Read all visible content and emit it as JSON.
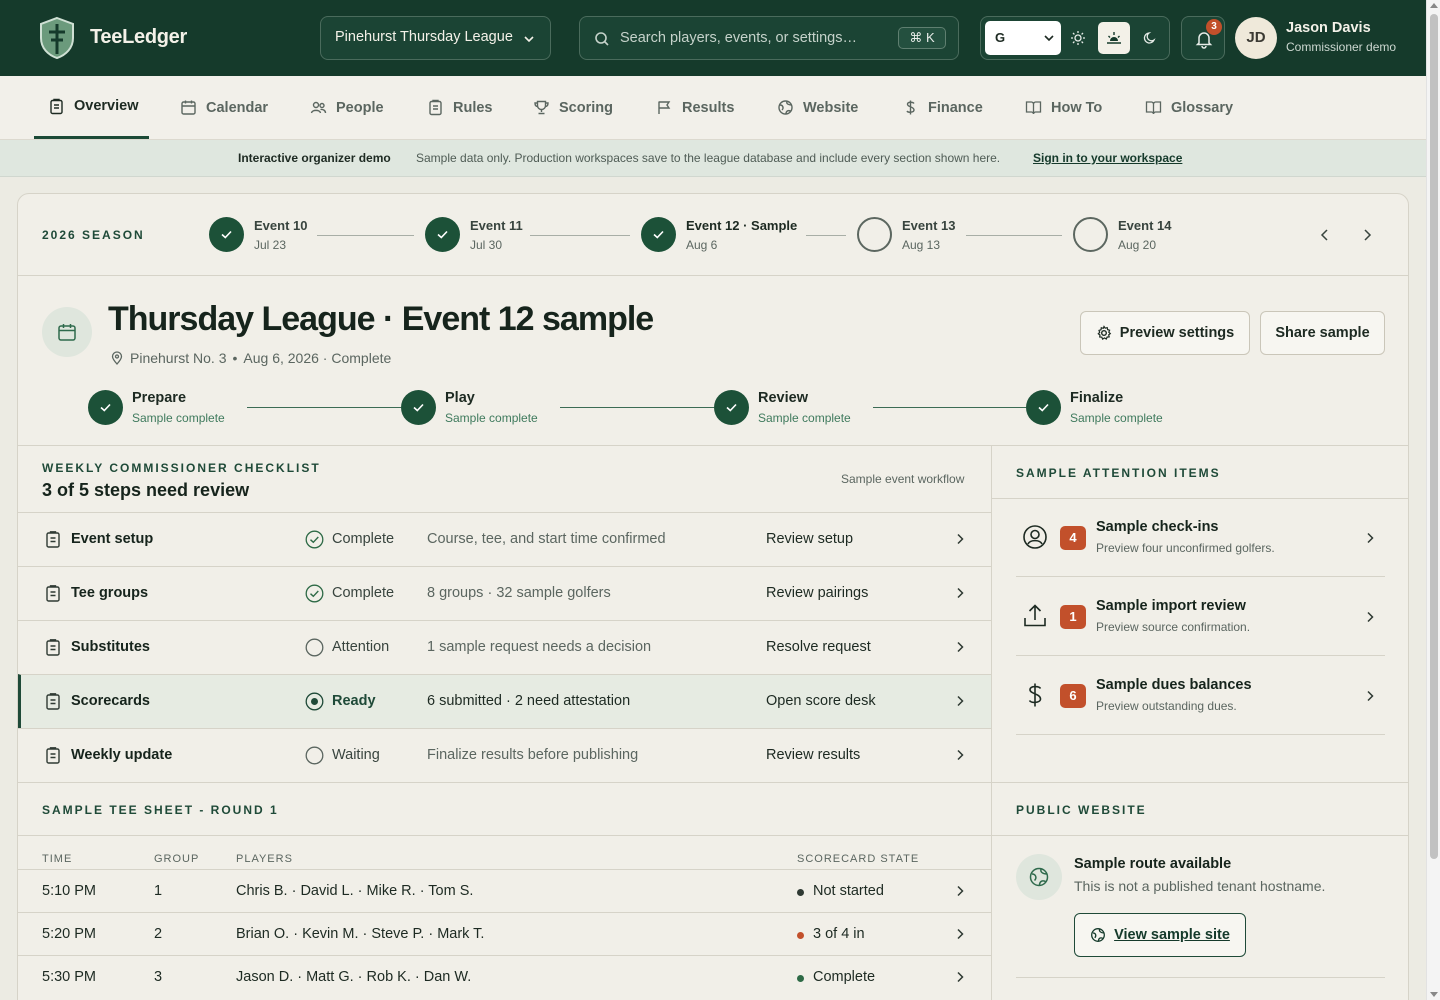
{
  "app": {
    "brand": "TeeLedger"
  },
  "header": {
    "league": "Pinehurst Thursday League",
    "search_placeholder": "Search players, events, or settings…",
    "shortcut": "⌘ K",
    "grade_select": "G",
    "notifications_count": "3",
    "user": {
      "initials": "JD",
      "name": "Jason Davis",
      "role": "Commissioner demo"
    }
  },
  "nav": [
    {
      "label": "Overview",
      "icon": "clipboard-icon",
      "active": true
    },
    {
      "label": "Calendar",
      "icon": "calendar-icon"
    },
    {
      "label": "People",
      "icon": "people-icon"
    },
    {
      "label": "Rules",
      "icon": "clipboard-icon"
    },
    {
      "label": "Scoring",
      "icon": "trophy-icon"
    },
    {
      "label": "Results",
      "icon": "flag-icon"
    },
    {
      "label": "Website",
      "icon": "globe-icon"
    },
    {
      "label": "Finance",
      "icon": "dollar-icon"
    },
    {
      "label": "How To",
      "icon": "book-icon"
    },
    {
      "label": "Glossary",
      "icon": "book-icon"
    }
  ],
  "banner": {
    "title": "Interactive organizer demo",
    "text": "Sample data only. Production workspaces save to the league database and include every section shown here.",
    "link": "Sign in to your workspace"
  },
  "season": {
    "label": "2026 SEASON",
    "events": [
      {
        "name": "Event 10",
        "date": "Jul 23",
        "status": "done"
      },
      {
        "name": "Event 11",
        "date": "Jul 30",
        "status": "done"
      },
      {
        "name": "Event 12 · Sample",
        "date": "Aug 6",
        "status": "done",
        "current": true
      },
      {
        "name": "Event 13",
        "date": "Aug 13",
        "status": "todo"
      },
      {
        "name": "Event 14",
        "date": "Aug 20",
        "status": "todo"
      }
    ]
  },
  "event": {
    "title": "Thursday League · Event 12 sample",
    "course": "Pinehurst No. 3",
    "separator": "•",
    "date_status": "Aug 6, 2026 · Complete",
    "preview_button": "Preview settings",
    "share_button": "Share sample",
    "phases": [
      {
        "name": "Prepare",
        "status": "Sample complete"
      },
      {
        "name": "Play",
        "status": "Sample complete"
      },
      {
        "name": "Review",
        "status": "Sample complete"
      },
      {
        "name": "Finalize",
        "status": "Sample complete"
      }
    ]
  },
  "checklist": {
    "kicker": "WEEKLY COMMISSIONER CHECKLIST",
    "heading": "3 of 5 steps need review",
    "note": "Sample event workflow",
    "rows": [
      {
        "name": "Event setup",
        "status": "Complete",
        "state": "complete",
        "detail": "Course, tee, and start time confirmed",
        "action": "Review setup"
      },
      {
        "name": "Tee groups",
        "status": "Complete",
        "state": "complete",
        "detail": "8 groups · 32 sample golfers",
        "action": "Review pairings"
      },
      {
        "name": "Substitutes",
        "status": "Attention",
        "state": "open",
        "detail": "1 sample request needs a decision",
        "action": "Resolve request"
      },
      {
        "name": "Scorecards",
        "status": "Ready",
        "state": "ready",
        "detail": "6 submitted · 2 need attestation",
        "action": "Open score desk"
      },
      {
        "name": "Weekly update",
        "status": "Waiting",
        "state": "open",
        "detail": "Finalize results before publishing",
        "action": "Review results"
      }
    ]
  },
  "attention": {
    "kicker": "SAMPLE ATTENTION ITEMS",
    "items": [
      {
        "icon": "user-circle-icon",
        "count": "4",
        "title": "Sample check-ins",
        "desc": "Preview four unconfirmed golfers."
      },
      {
        "icon": "upload-icon",
        "count": "1",
        "title": "Sample import review",
        "desc": "Preview source confirmation."
      },
      {
        "icon": "dollar-icon",
        "count": "6",
        "title": "Sample dues balances",
        "desc": "Preview outstanding dues."
      }
    ]
  },
  "tee_sheet": {
    "kicker": "SAMPLE TEE SHEET - ROUND 1",
    "columns": [
      "TIME",
      "GROUP",
      "PLAYERS",
      "SCORECARD STATE"
    ],
    "rows": [
      {
        "time": "5:10 PM",
        "group": "1",
        "players": "Chris B. · David L. · Mike R. · Tom S.",
        "state": "Not started",
        "dot": "#2f3a33"
      },
      {
        "time": "5:20 PM",
        "group": "2",
        "players": "Brian O. · Kevin M. · Steve P. · Mark T.",
        "state": "3 of 4 in",
        "dot": "#c2502b"
      },
      {
        "time": "5:30 PM",
        "group": "3",
        "players": "Jason D. · Matt G. · Rob K. · Dan W.",
        "state": "Complete",
        "dot": "#2e6a46"
      }
    ]
  },
  "public_site": {
    "kicker": "PUBLIC WEBSITE",
    "title": "Sample route available",
    "desc": "This is not a published tenant hostname.",
    "button": "View sample site"
  },
  "colors": {
    "primary": "#153a2b",
    "accent": "#c2502b",
    "success": "#1c5138",
    "background": "#ecebe3"
  }
}
